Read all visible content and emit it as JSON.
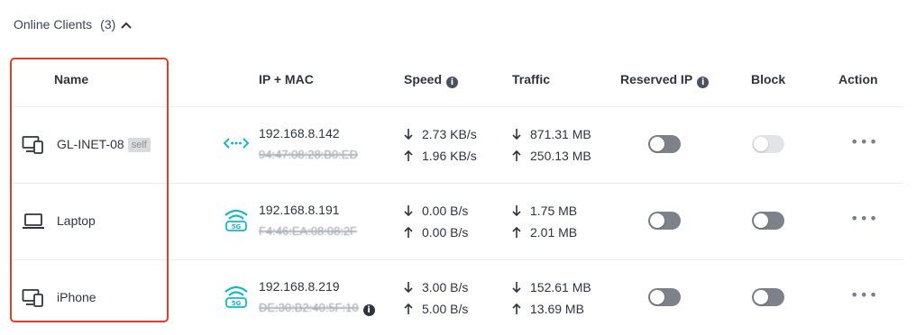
{
  "section": {
    "title": "Online Clients",
    "count": "(3)"
  },
  "columns": {
    "name": "Name",
    "ip_mac": "IP + MAC",
    "speed": "Speed",
    "traffic": "Traffic",
    "reserved_ip": "Reserved IP",
    "block": "Block",
    "action": "Action"
  },
  "clients": [
    {
      "name": "GL-INET-08",
      "badge": "self",
      "device_icon": "desktop-phone-icon",
      "connection_icon": "ethernet-icon",
      "ip": "192.168.8.142",
      "mac": "94:47:08:28:B0:ED",
      "speed_down": "2.73 KB/s",
      "speed_up": "1.96 KB/s",
      "traffic_down": "871.31 MB",
      "traffic_up": "250.13 MB",
      "reserved_ip": false,
      "block": false,
      "block_disabled": true
    },
    {
      "name": "Laptop",
      "device_icon": "laptop-icon",
      "connection_icon": "wifi-5g-icon",
      "ip": "192.168.8.191",
      "mac": "F4:46:EA:08:08:2F",
      "speed_down": "0.00 B/s",
      "speed_up": "0.00 B/s",
      "traffic_down": "1.75 MB",
      "traffic_up": "2.01 MB",
      "reserved_ip": false,
      "block": false
    },
    {
      "name": "iPhone",
      "device_icon": "desktop-phone-icon",
      "connection_icon": "wifi-5g-icon",
      "ip": "192.168.8.219",
      "mac": "DE:30:B2:40:5F:10",
      "speed_down": "3.00 B/s",
      "speed_up": "5.00 B/s",
      "traffic_down": "152.61 MB",
      "traffic_up": "13.69 MB",
      "reserved_ip": false,
      "block": false
    }
  ],
  "colors": {
    "accent_teal": "#19b6c4",
    "highlight_red": "#e03c2c",
    "toggle_off": "#7d8189"
  }
}
